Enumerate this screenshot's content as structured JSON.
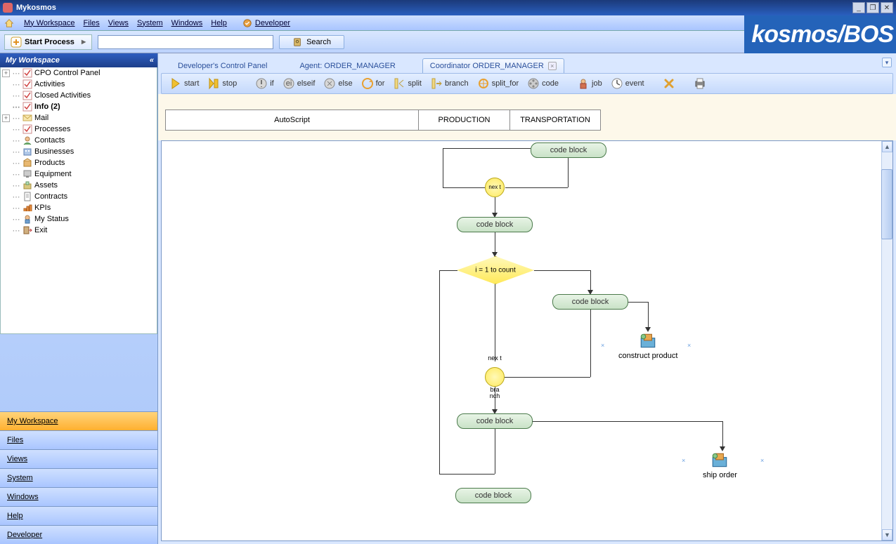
{
  "app": {
    "title": "Mykosmos",
    "brand": "kosmos/BOS"
  },
  "window_buttons": {
    "min": "_",
    "max": "❐",
    "close": "✕"
  },
  "menu": {
    "items": [
      "My Workspace",
      "Files",
      "Views",
      "System",
      "Windows",
      "Help"
    ],
    "developer": "Developer"
  },
  "toolbar": {
    "start_process": "Start Process",
    "search_label": "Search",
    "search_value": ""
  },
  "sidebar": {
    "title": "My Workspace",
    "tree": [
      {
        "label": "CPO Control Panel",
        "icon": "check",
        "expander": "+"
      },
      {
        "label": "Activities",
        "icon": "check"
      },
      {
        "label": "Closed Activities",
        "icon": "check"
      },
      {
        "label": "Info (2)",
        "icon": "check",
        "bold": true
      },
      {
        "label": "Mail",
        "icon": "mail",
        "expander": "+"
      },
      {
        "label": "Processes",
        "icon": "check"
      },
      {
        "label": "Contacts",
        "icon": "contact"
      },
      {
        "label": "Businesses",
        "icon": "biz"
      },
      {
        "label": "Products",
        "icon": "product"
      },
      {
        "label": "Equipment",
        "icon": "equip"
      },
      {
        "label": "Assets",
        "icon": "asset"
      },
      {
        "label": "Contracts",
        "icon": "contract"
      },
      {
        "label": "KPIs",
        "icon": "kpi"
      },
      {
        "label": "My Status",
        "icon": "status"
      },
      {
        "label": "Exit",
        "icon": "exit"
      }
    ],
    "nav": [
      "My Workspace",
      "Files",
      "Views",
      "System",
      "Windows",
      "Help",
      "Developer"
    ],
    "nav_active_index": 0
  },
  "tabs": {
    "items": [
      {
        "label": "Developer's Control Panel",
        "active": false
      },
      {
        "label": "Agent: ORDER_MANAGER",
        "active": false
      },
      {
        "label": "Coordinator ORDER_MANAGER",
        "active": true
      }
    ]
  },
  "flow_toolbar": {
    "items": [
      {
        "icon": "play",
        "label": "start"
      },
      {
        "icon": "stop",
        "label": "stop"
      },
      {
        "sep": true
      },
      {
        "icon": "if",
        "label": "if"
      },
      {
        "icon": "elseif",
        "label": "elseif"
      },
      {
        "icon": "else",
        "label": "else"
      },
      {
        "icon": "for",
        "label": "for"
      },
      {
        "icon": "split",
        "label": "split"
      },
      {
        "icon": "branch",
        "label": "branch"
      },
      {
        "icon": "splitfor",
        "label": "split_for"
      },
      {
        "icon": "code",
        "label": "code"
      },
      {
        "sep": true
      },
      {
        "icon": "job",
        "label": "job"
      },
      {
        "icon": "event",
        "label": "event"
      },
      {
        "sep": true
      },
      {
        "icon": "delete",
        "label": ""
      },
      {
        "sep": true
      },
      {
        "icon": "print",
        "label": ""
      }
    ]
  },
  "subtabs": [
    "AutoScript",
    "PRODUCTION",
    "TRANSPORTATION"
  ],
  "flow": {
    "nodes": {
      "code1": "code block",
      "next1": "nex t",
      "code2": "code block",
      "loop": "i = 1 to count",
      "code3": "code block",
      "task1": "construct product",
      "next2_top": "nex t",
      "next2_bot": "bra nch",
      "code4": "code block",
      "task2": "ship order",
      "code5": "code block"
    }
  }
}
